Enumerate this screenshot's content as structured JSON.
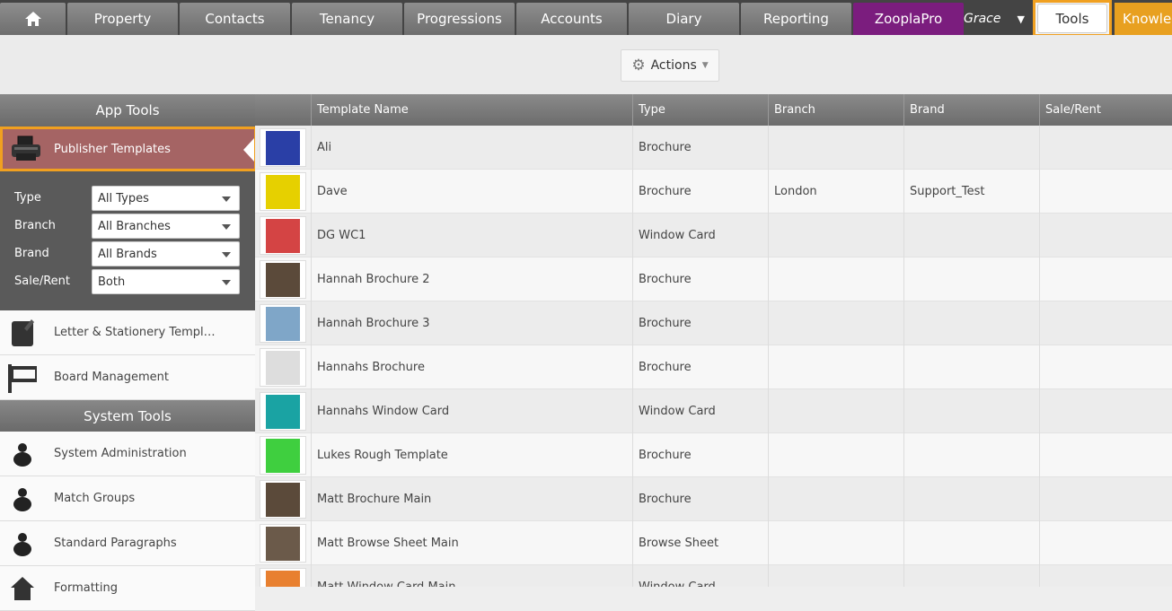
{
  "nav": {
    "tabs": [
      {
        "label": "Property"
      },
      {
        "label": "Contacts"
      },
      {
        "label": "Tenancy"
      },
      {
        "label": "Progressions"
      },
      {
        "label": "Accounts"
      },
      {
        "label": "Diary"
      },
      {
        "label": "Reporting"
      },
      {
        "label": "ZooplaPro"
      }
    ],
    "user": "Grace",
    "tools": "Tools",
    "knowledge": "Knowledge"
  },
  "toolbar": {
    "actions_label": "Actions"
  },
  "sidebar": {
    "app_tools_header": "App Tools",
    "publisher_templates": "Publisher Templates",
    "filters": [
      {
        "label": "Type",
        "value": "All Types"
      },
      {
        "label": "Branch",
        "value": "All Branches"
      },
      {
        "label": "Brand",
        "value": "All Brands"
      },
      {
        "label": "Sale/Rent",
        "value": "Both"
      }
    ],
    "app_items": [
      {
        "label": "Letter & Stationery Templa...",
        "icon": "letter-icon"
      },
      {
        "label": "Board Management",
        "icon": "board-icon"
      }
    ],
    "system_tools_header": "System Tools",
    "system_items": [
      {
        "label": "System Administration",
        "icon": "person-icon"
      },
      {
        "label": "Match Groups",
        "icon": "person-icon"
      },
      {
        "label": "Standard Paragraphs",
        "icon": "person-icon"
      },
      {
        "label": "Formatting",
        "icon": "home-icon"
      }
    ]
  },
  "table": {
    "headers": [
      "Template Name",
      "Type",
      "Branch",
      "Brand",
      "Sale/Rent"
    ],
    "rows": [
      {
        "name": "Ali",
        "type": "Brochure",
        "branch": "",
        "brand": "",
        "sale_rent": "",
        "thumb": "#2a3fa6"
      },
      {
        "name": "Dave",
        "type": "Brochure",
        "branch": "London",
        "brand": "Support_Test",
        "sale_rent": "",
        "thumb": "#e6d000"
      },
      {
        "name": "DG WC1",
        "type": "Window Card",
        "branch": "",
        "brand": "",
        "sale_rent": "",
        "thumb": "#d44444"
      },
      {
        "name": "Hannah Brochure 2",
        "type": "Brochure",
        "branch": "",
        "brand": "",
        "sale_rent": "",
        "thumb": "#5b4a3a"
      },
      {
        "name": "Hannah Brochure 3",
        "type": "Brochure",
        "branch": "",
        "brand": "",
        "sale_rent": "",
        "thumb": "#7fa6c8"
      },
      {
        "name": "Hannahs Brochure",
        "type": "Brochure",
        "branch": "",
        "brand": "",
        "sale_rent": "",
        "thumb": "#dddddd"
      },
      {
        "name": "Hannahs Window Card",
        "type": "Window Card",
        "branch": "",
        "brand": "",
        "sale_rent": "",
        "thumb": "#1aa3a3"
      },
      {
        "name": "Lukes Rough Template",
        "type": "Brochure",
        "branch": "",
        "brand": "",
        "sale_rent": "",
        "thumb": "#3fcf3f"
      },
      {
        "name": "Matt Brochure Main",
        "type": "Brochure",
        "branch": "",
        "brand": "",
        "sale_rent": "",
        "thumb": "#5b4a3a"
      },
      {
        "name": "Matt Browse Sheet Main",
        "type": "Browse Sheet",
        "branch": "",
        "brand": "",
        "sale_rent": "",
        "thumb": "#6b5a4a"
      },
      {
        "name": "Matt Window Card Main",
        "type": "Window Card",
        "branch": "",
        "brand": "",
        "sale_rent": "",
        "thumb": "#e88030"
      }
    ]
  }
}
